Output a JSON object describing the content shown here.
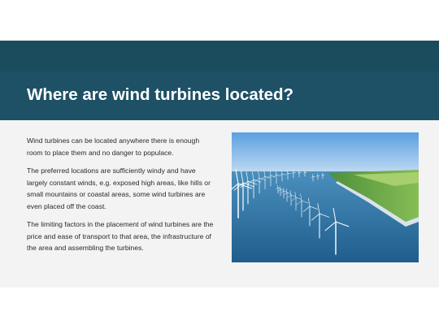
{
  "slide": {
    "title": "Where are wind turbines located?",
    "paragraphs": [
      "Wind turbines can be located anywhere there is enough room to place them and no danger to populace.",
      "The preferred locations are sufficiently windy and have largely constant winds, e.g. exposed high areas, like hills or small mountains or coastal areas, some wind turbines are even placed off the coast.",
      "The limiting factors in the placement of wind turbines are the price and ease of transport to that area, the infrastructure of the area and assembling the turbines."
    ]
  },
  "photo": {
    "subject": "offshore-wind-farm",
    "colors": {
      "sky": "#7fb9e8",
      "water": "#2c6f9d",
      "land": "#6da64a"
    }
  },
  "colors": {
    "header": "#1e5166",
    "slide_bg": "#f3f3f3",
    "title_text": "#ffffff",
    "body_text": "#2a2a2a"
  }
}
